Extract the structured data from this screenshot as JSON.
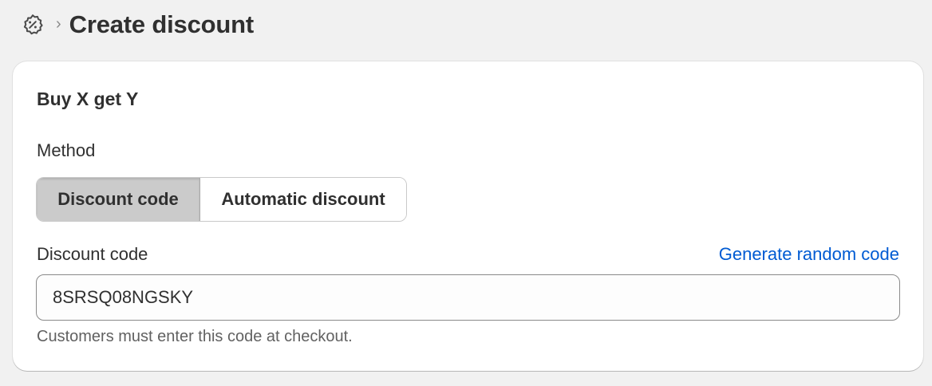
{
  "header": {
    "icon": "discount-badge-icon",
    "chevron": "›",
    "title": "Create discount"
  },
  "card": {
    "title": "Buy X get Y",
    "method": {
      "label": "Method",
      "options": [
        "Discount code",
        "Automatic discount"
      ],
      "selected": "Discount code"
    },
    "discount_code": {
      "label": "Discount code",
      "generate_link": "Generate random code",
      "value": "8SRSQ08NGSKY",
      "help_text": "Customers must enter this code at checkout."
    }
  },
  "colors": {
    "background": "#f1f1f1",
    "card": "#ffffff",
    "link": "#005bd3",
    "selected_segment": "#cbcbcb",
    "text": "#303030",
    "subdued_text": "#616161"
  }
}
